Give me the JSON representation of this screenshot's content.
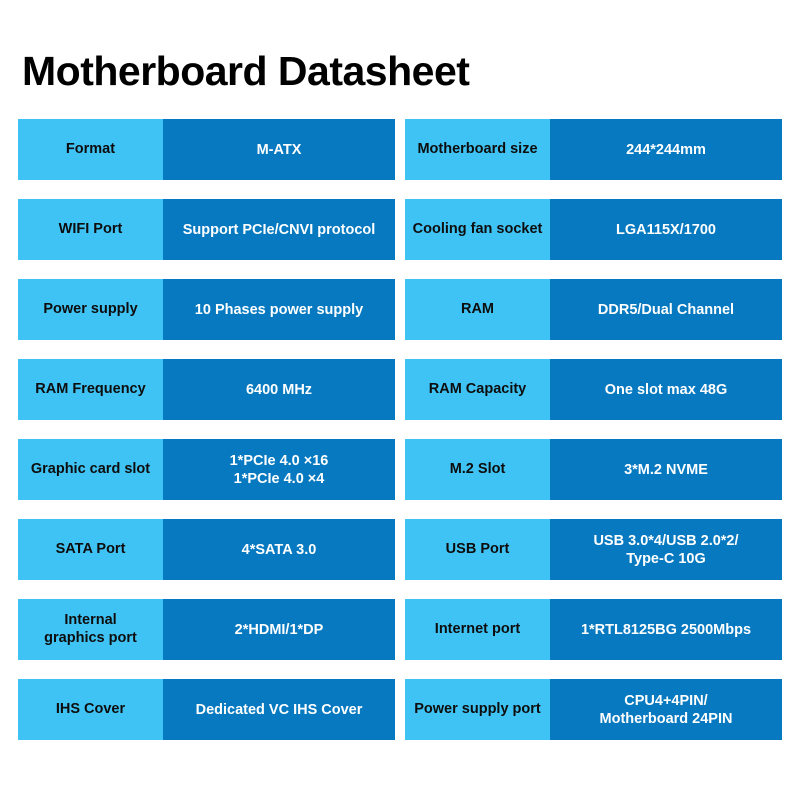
{
  "document": {
    "title": "Motherboard Datasheet",
    "colors": {
      "label_background": "#3fc3f5",
      "value_background": "#0679c0",
      "label_text": "#0d0d0d",
      "value_text": "#ffffff",
      "page_background": "#ffffff",
      "title_text": "#000000"
    }
  },
  "spec_table": {
    "left_column": [
      {
        "label": "Format",
        "value": "M-ATX"
      },
      {
        "label": "WIFI Port",
        "value": "Support PCIe/CNVI protocol"
      },
      {
        "label": "Power supply",
        "value": "10 Phases power supply"
      },
      {
        "label": "RAM Frequency",
        "value": "6400 MHz"
      },
      {
        "label": "Graphic card slot",
        "value_line1": "1*PCIe 4.0 ×16",
        "value_line2": "1*PCIe 4.0 ×4"
      },
      {
        "label": "SATA Port",
        "value": "4*SATA 3.0"
      },
      {
        "label_line1": "Internal",
        "label_line2": "graphics port",
        "value": "2*HDMI/1*DP"
      },
      {
        "label": "IHS Cover",
        "value": "Dedicated VC IHS Cover"
      }
    ],
    "right_column": [
      {
        "label": "Motherboard size",
        "value": "244*244mm"
      },
      {
        "label": "Cooling fan socket",
        "value": "LGA115X/1700"
      },
      {
        "label": "RAM",
        "value": "DDR5/Dual Channel"
      },
      {
        "label": "RAM Capacity",
        "value": "One slot max 48G"
      },
      {
        "label": "M.2 Slot",
        "value": "3*M.2 NVME"
      },
      {
        "label": "USB Port",
        "value_line1": "USB 3.0*4/USB 2.0*2/",
        "value_line2": "Type-C 10G"
      },
      {
        "label": "Internet port",
        "value": "1*RTL8125BG 2500Mbps"
      },
      {
        "label": "Power supply port",
        "value_line1": "CPU4+4PIN/",
        "value_line2": "Motherboard 24PIN"
      }
    ]
  }
}
